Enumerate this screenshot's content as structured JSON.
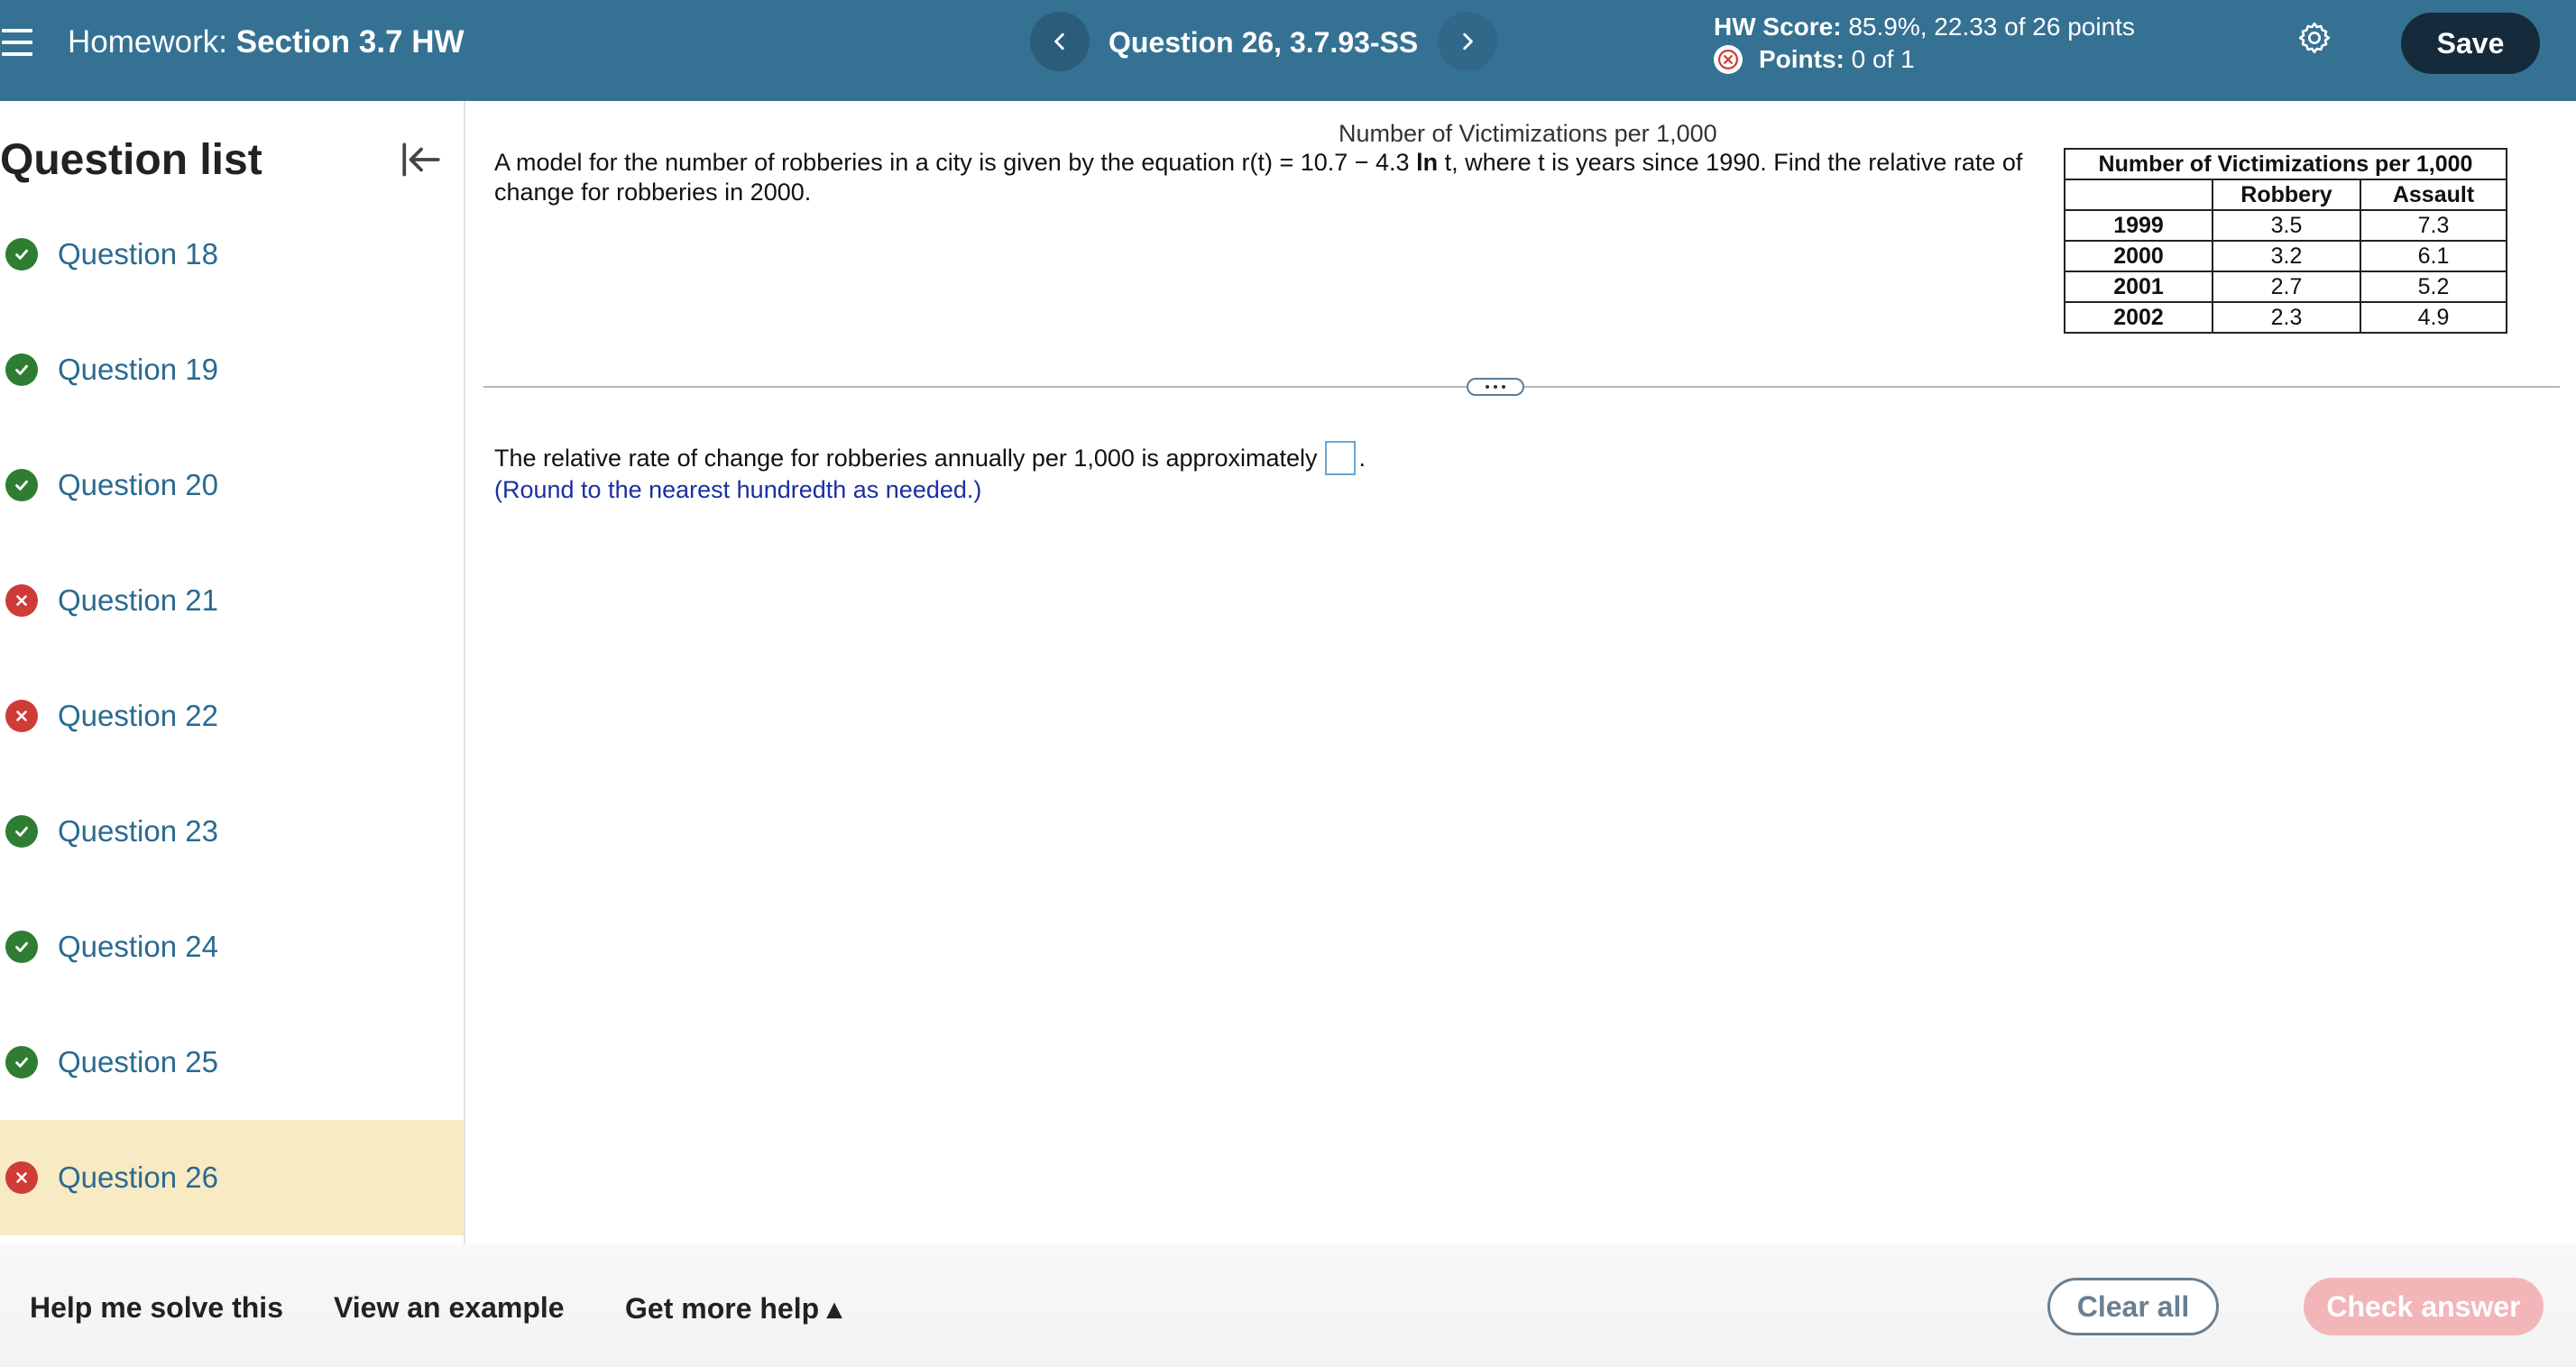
{
  "header": {
    "homework_prefix": "Homework:",
    "homework_name": "Section 3.7 HW",
    "question_title": "Question 26, 3.7.93-SS",
    "hw_score_label": "HW Score:",
    "hw_score_value": "85.9%, 22.33 of 26 points",
    "points_label": "Points:",
    "points_value": "0 of 1",
    "save_label": "Save"
  },
  "sidebar": {
    "title": "Question list",
    "items": [
      {
        "label": "Question 18",
        "status": "correct"
      },
      {
        "label": "Question 19",
        "status": "correct"
      },
      {
        "label": "Question 20",
        "status": "correct"
      },
      {
        "label": "Question 21",
        "status": "incorrect"
      },
      {
        "label": "Question 22",
        "status": "incorrect"
      },
      {
        "label": "Question 23",
        "status": "correct"
      },
      {
        "label": "Question 24",
        "status": "correct"
      },
      {
        "label": "Question 25",
        "status": "correct"
      },
      {
        "label": "Question 26",
        "status": "incorrect",
        "active": true
      }
    ]
  },
  "question": {
    "table_caption": "Number of Victimizations per 1,000",
    "text_part1": "A model for the number of robberies in a city is given by the equation r(t) = 10.7 − 4.3 ",
    "text_ln": "ln",
    "text_part2": " t, where t is years since 1990. Find the relative rate of change for robberies in 2000.",
    "answer_prompt": "The relative rate of change for robberies annually per 1,000 is approximately",
    "answer_suffix": ".",
    "answer_value": "",
    "hint": "(Round to the nearest hundredth as needed.)"
  },
  "table": {
    "title": "Number of Victimizations per 1,000",
    "columns": [
      "",
      "Robbery",
      "Assault"
    ],
    "rows": [
      [
        "1999",
        "3.5",
        "7.3"
      ],
      [
        "2000",
        "3.2",
        "6.1"
      ],
      [
        "2001",
        "2.7",
        "5.2"
      ],
      [
        "2002",
        "2.3",
        "4.9"
      ]
    ]
  },
  "footer": {
    "help_solve": "Help me solve this",
    "view_example": "View an example",
    "more_help": "Get more help ▴",
    "clear_all": "Clear all",
    "check_answer": "Check answer"
  },
  "colors": {
    "topbar": "#357193",
    "correct": "#2e7d32",
    "incorrect": "#cf3b37",
    "active_item": "#f8eac3",
    "link": "#2a6a90"
  }
}
